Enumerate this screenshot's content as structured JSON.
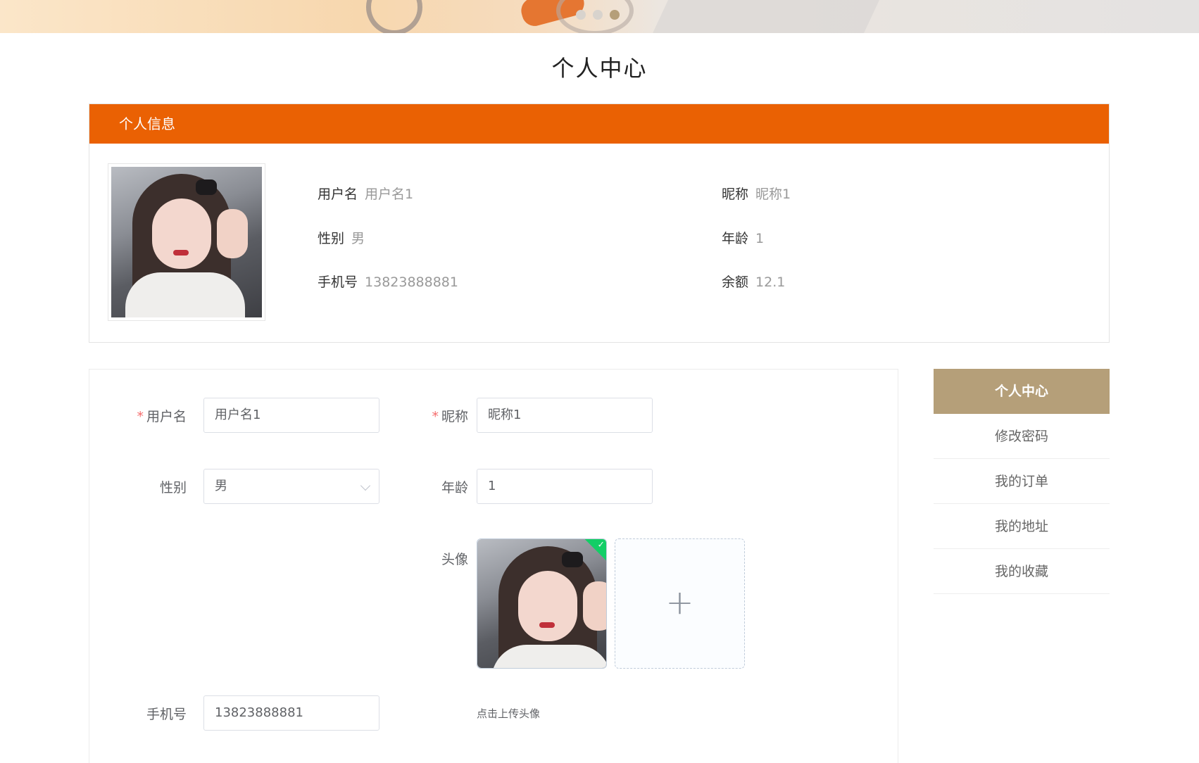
{
  "banner": {
    "dots": 3,
    "active_dot": 3
  },
  "page": {
    "title": "个人中心"
  },
  "info": {
    "header": "个人信息",
    "fields": {
      "username_label": "用户名",
      "username_value": "用户名1",
      "nickname_label": "昵称",
      "nickname_value": "昵称1",
      "gender_label": "性别",
      "gender_value": "男",
      "age_label": "年龄",
      "age_value": "1",
      "phone_label": "手机号",
      "phone_value": "13823888881",
      "balance_label": "余额",
      "balance_value": "12.1"
    }
  },
  "form": {
    "required_mark": "*",
    "username": {
      "label": "用户名",
      "value": "用户名1"
    },
    "nickname": {
      "label": "昵称",
      "value": "昵称1"
    },
    "gender": {
      "label": "性别",
      "value": "男"
    },
    "age": {
      "label": "年龄",
      "value": "1"
    },
    "avatar": {
      "label": "头像",
      "check": "✓",
      "add": "+",
      "tip": "点击上传头像"
    },
    "phone": {
      "label": "手机号",
      "value": "13823888881"
    }
  },
  "menu": {
    "items": [
      {
        "label": "个人中心",
        "active": true
      },
      {
        "label": "修改密码"
      },
      {
        "label": "我的订单"
      },
      {
        "label": "我的地址"
      },
      {
        "label": "我的收藏"
      }
    ]
  },
  "colors": {
    "accent": "#ea6103",
    "menu_active": "#b59f79",
    "upload_success": "#13ce66"
  }
}
